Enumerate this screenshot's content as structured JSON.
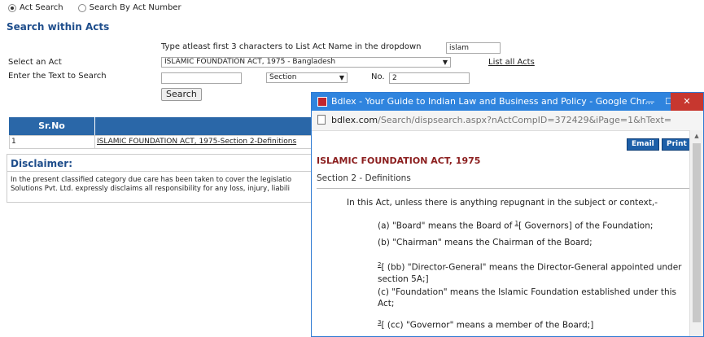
{
  "search_mode": {
    "act_search": "Act Search",
    "by_number": "Search By Act Number"
  },
  "heading": "Search within Acts",
  "hint": "Type atleast first 3 characters to List Act Name in the dropdown",
  "hint_input_value": "islam",
  "select_act_label": "Select an Act",
  "select_act_value": "ISLAMIC FOUNDATION ACT, 1975 - Bangladesh",
  "list_all_acts": "List all Acts",
  "text_search_label": "Enter the Text to Search",
  "text_search_value": "",
  "section_select_value": "Section",
  "no_label": "No.",
  "no_value": "2",
  "search_button": "Search",
  "results": {
    "col_srno": "Sr.No",
    "rows": [
      {
        "srno": "1",
        "title": "ISLAMIC FOUNDATION ACT, 1975-Section 2-Definitions"
      }
    ]
  },
  "disclaimer": {
    "title": "Disclaimer:",
    "line1": "In the present classified category due care has been taken to cover the legislatio",
    "line2": "Solutions Pvt. Ltd. expressly disclaims all responsibility for any loss, injury, liabili"
  },
  "popup": {
    "title": "Bdlex - Your Guide to Indian Law and Business and Policy - Google Chr...",
    "url_host": "bdlex.com",
    "url_path": "/Search/dispsearch.aspx?nActCompID=372429&iPage=1&hText=",
    "email_button": "Email",
    "print_button": "Print",
    "act_title": "ISLAMIC FOUNDATION ACT, 1975",
    "section": "Section 2 - Definitions",
    "intro": "In this Act, unless there is anything repugnant in the subject or context,-",
    "def_a_pre": "(a) \"Board\" means the Board of ",
    "def_a_sup": "1",
    "def_a_post": "[ Governors] of the Foundation;",
    "def_b": "(b) \"Chairman\" means the Chairman of the Board;",
    "def_bb_sup": "2",
    "def_bb_line1": "[ (bb) \"Director-General\" means the Director-General appointed under",
    "def_bb_line2": "section 5A;]",
    "def_c_line1": "(c) \"Foundation\" means the Islamic Foundation established under this",
    "def_c_line2": "Act;",
    "def_cc_sup": "3",
    "def_cc": "[ (cc) \"Governor\" means a member of the Board;]"
  }
}
